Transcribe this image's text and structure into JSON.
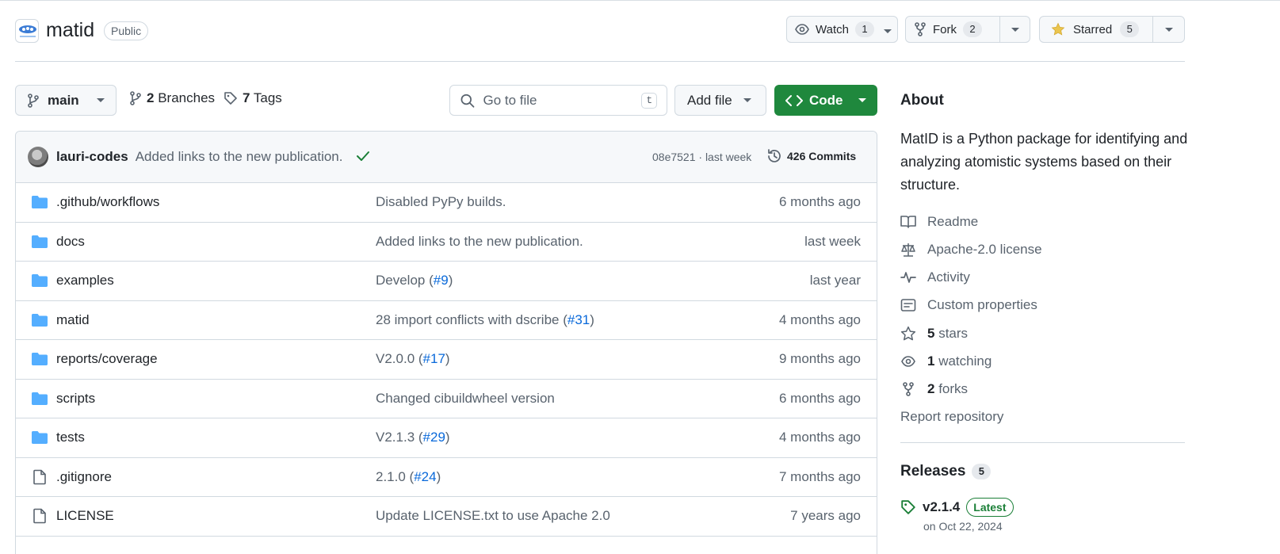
{
  "repo": {
    "name": "matid",
    "visibility": "Public",
    "watch_label": "Watch",
    "watch_count": "1",
    "fork_label": "Fork",
    "fork_count": "2",
    "star_label": "Starred",
    "star_count": "5"
  },
  "toolbar": {
    "branch": "main",
    "branches_count": "2",
    "branches_label": "Branches",
    "tags_count": "7",
    "tags_label": "Tags",
    "goto_placeholder": "Go to file",
    "goto_shortcut": "t",
    "add_file_label": "Add file",
    "code_label": "Code"
  },
  "commit": {
    "author": "lauri-codes",
    "message": "Added links to the new publication.",
    "sha_time": "08e7521 · last week",
    "commits_count": "426",
    "commits_label": "Commits"
  },
  "files": [
    {
      "type": "folder",
      "name": ".github/workflows",
      "msg": "Disabled PyPy builds.",
      "link": "",
      "suffix": "",
      "date": "6 months ago"
    },
    {
      "type": "folder",
      "name": "docs",
      "msg": "Added links to the new publication.",
      "link": "",
      "suffix": "",
      "date": "last week"
    },
    {
      "type": "folder",
      "name": "examples",
      "msg": "Develop (",
      "link": "#9",
      "suffix": ")",
      "date": "last year"
    },
    {
      "type": "folder",
      "name": "matid",
      "msg": "28 import conflicts with dscribe (",
      "link": "#31",
      "suffix": ")",
      "date": "4 months ago"
    },
    {
      "type": "folder",
      "name": "reports/coverage",
      "msg": "V2.0.0 (",
      "link": "#17",
      "suffix": ")",
      "date": "9 months ago"
    },
    {
      "type": "folder",
      "name": "scripts",
      "msg": "Changed cibuildwheel version",
      "link": "",
      "suffix": "",
      "date": "6 months ago"
    },
    {
      "type": "folder",
      "name": "tests",
      "msg": "V2.1.3 (",
      "link": "#29",
      "suffix": ")",
      "date": "4 months ago"
    },
    {
      "type": "file",
      "name": ".gitignore",
      "msg": "2.1.0 (",
      "link": "#24",
      "suffix": ")",
      "date": "7 months ago"
    },
    {
      "type": "file",
      "name": "LICENSE",
      "msg": "Update LICENSE.txt to use Apache 2.0",
      "link": "",
      "suffix": "",
      "date": "7 years ago"
    }
  ],
  "about": {
    "title": "About",
    "description": "MatID is a Python package for identifying and analyzing atomistic systems based on their structure.",
    "readme": "Readme",
    "license": "Apache-2.0 license",
    "activity": "Activity",
    "custom_properties": "Custom properties",
    "stars_count": "5",
    "stars_label": "stars",
    "watching_count": "1",
    "watching_label": "watching",
    "forks_count": "2",
    "forks_label": "forks",
    "report": "Report repository"
  },
  "releases": {
    "title": "Releases",
    "count": "5",
    "latest_tag": "v2.1.4",
    "latest_badge": "Latest",
    "latest_date": "on Oct 22, 2024"
  },
  "colors": {
    "accent_green": "#1f883d",
    "link_blue": "#0969da",
    "folder_blue": "#54aeff",
    "star_yellow": "#eac54f"
  }
}
